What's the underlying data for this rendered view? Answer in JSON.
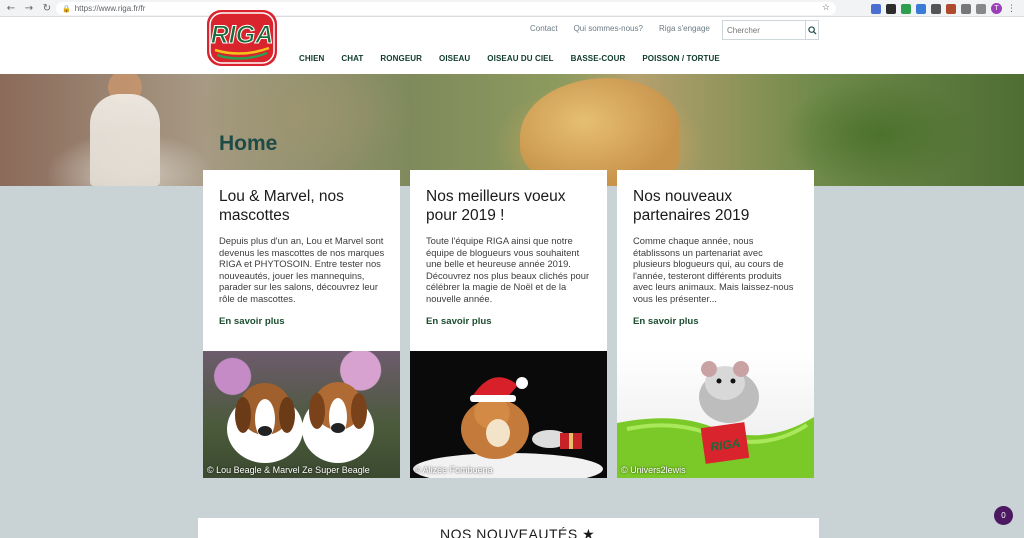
{
  "browser": {
    "url": "https://www.riga.fr/fr",
    "profile_initial": "T"
  },
  "header": {
    "logo_text": "RIGA",
    "top_links": [
      "Contact",
      "Qui sommes-nous?",
      "Riga s'engage"
    ],
    "search_placeholder": "Chercher",
    "nav": [
      "CHIEN",
      "CHAT",
      "RONGEUR",
      "OISEAU",
      "OISEAU DU CIEL",
      "BASSE-COUR",
      "POISSON / TORTUE"
    ]
  },
  "hero": {
    "title": "Home"
  },
  "cards": [
    {
      "title": " Lou & Marvel, nos mascottes",
      "text": "Depuis plus d'un an, Lou et Marvel sont devenus les mascottes de nos marques RIGA et PHYTOSOIN. Entre tester nos nouveautés, jouer les mannequins, parader sur les salons, découvrez leur rôle de mascottes.",
      "link": "En savoir plus",
      "caption": "© Lou Beagle & Marvel Ze Super Beagle"
    },
    {
      "title": "Nos meilleurs voeux pour 2019 !",
      "text": "Toute l'équipe RIGA ainsi que notre équipe de blogueurs vous souhaitent une belle et heureuse année 2019. Découvrez nos plus beaux clichés pour célébrer la magie de Noël et de la nouvelle année.",
      "link": "En savoir plus",
      "caption": "© Alizée Fombuena"
    },
    {
      "title": "Nos nouveaux partenaires 2019",
      "text": "Comme chaque année, nous établissons un partenariat avec plusieurs blogueurs qui, au cours de l'année, testeront différents produits avec leurs animaux. Mais laissez-nous vous les présenter...",
      "link": "En savoir plus",
      "caption": "© Univers2lewis"
    }
  ],
  "nouveautes": {
    "title": "NOS NOUVEAUTÉS ★"
  },
  "cart_badge": "0",
  "colors": {
    "brand_red": "#d9232d",
    "brand_green": "#1b4d2f",
    "page_bg": "#c9d3d6",
    "badge": "#4b1861"
  }
}
